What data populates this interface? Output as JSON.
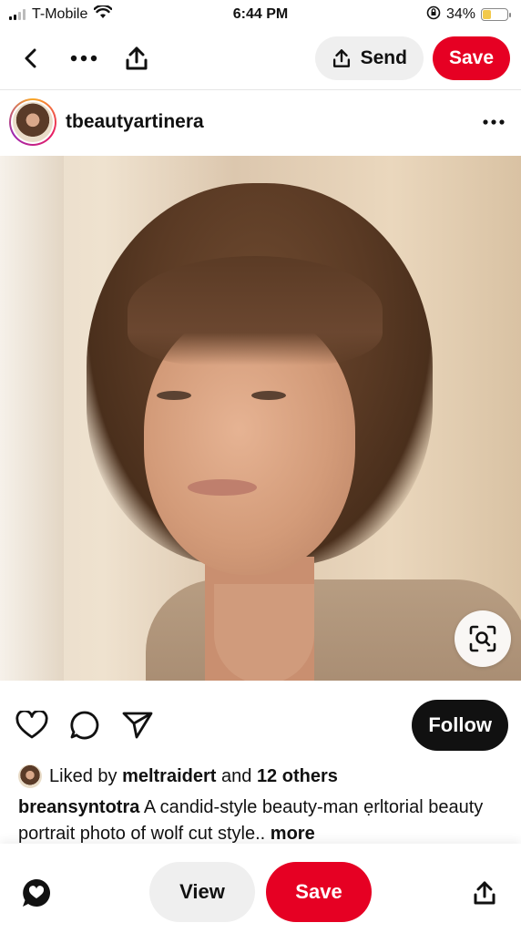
{
  "status_bar": {
    "carrier": "T-Mobile",
    "time": "6:44 PM",
    "battery_percent": "34%",
    "battery_level": 0.34
  },
  "top_nav": {
    "send_label": "Send",
    "save_label": "Save"
  },
  "profile": {
    "username": "tbeautyartinera"
  },
  "actions": {
    "follow_label": "Follow"
  },
  "likes": {
    "prefix": "Liked by",
    "user": "meltraidert",
    "connector": "and",
    "others": "12 others"
  },
  "caption": {
    "user": "breansyntotra",
    "text": " A candid-style beauty-man ẹrltorial beauty portrait photo  of wolf cut style..",
    "more": " more"
  },
  "bottom_bar": {
    "view_label": "View",
    "save_label": "Save"
  },
  "colors": {
    "accent": "#e60023",
    "follow": "#111111"
  }
}
